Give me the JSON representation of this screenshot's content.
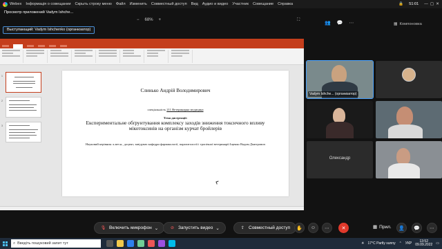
{
  "app": {
    "name": "Webex",
    "meeting_info": "Інформація о совещании",
    "hide_menu": "Скрыть строку меню",
    "time": "51:01"
  },
  "menu": [
    "Файл",
    "Изменить",
    "Совместный доступ",
    "Вид",
    "Аудио и видео",
    "Участник",
    "Совещание",
    "Справка"
  ],
  "viewer": {
    "title": "Просмотр приложений Vadym Ishche...",
    "speaker": "Выступающий: Vadym Ishchenko (организатор)",
    "zoom": "68%",
    "zoom_out": "−",
    "zoom_in": "+"
  },
  "layout_label": "Компоновка",
  "slide": {
    "author": "Слинько Андрій Володимирович",
    "specialty_prefix": "спеціальність",
    "specialty": "211 Ветеринарна медицина",
    "topic_label": "Тема дисертації:",
    "topic": "Експериментальне обґрунтування комплексу заходів зниження токсичного впливу мікотоксинів на організм курчат бройлерів",
    "supervisor": "Науковий керівник: к.вет.н., доцент, завідувач кафедри фармакології, паразитології і тропічної ветеринарії Іщенко Вадим Дмитрович"
  },
  "thumbnails": [
    "1",
    "2",
    "3"
  ],
  "participants": [
    {
      "name": "Vadym Ishche... (организатор)"
    },
    {
      "name": ""
    },
    {
      "name": ""
    },
    {
      "name": ""
    },
    {
      "name": "Олександр"
    },
    {
      "name": ""
    }
  ],
  "controls": {
    "mic": "Включить микрофон",
    "video": "Запустить видео",
    "share": "Совместный доступ",
    "apps": "Прил."
  },
  "taskbar": {
    "search_placeholder": "Введіть пошуковий запит тут",
    "weather": "17°C Partly sunny",
    "lang": "УКР",
    "time": "13:52",
    "date": "09.09.2022"
  },
  "colors": {
    "powerpoint_red": "#c43e1c",
    "active_outline": "#4aa3ff",
    "end_call": "#e0392b"
  }
}
